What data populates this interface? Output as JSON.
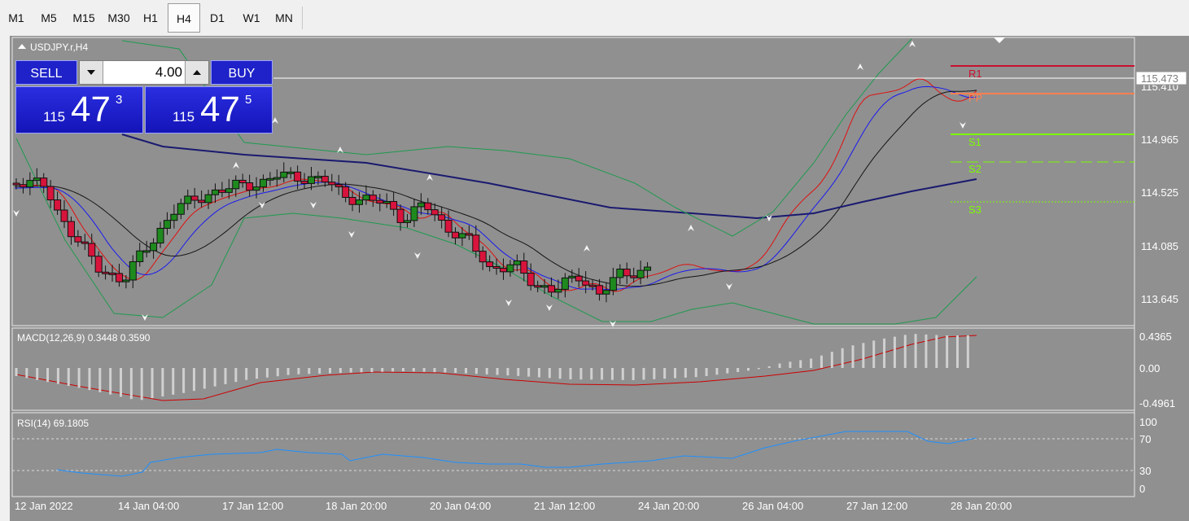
{
  "toolbar": {
    "timeframes": [
      "M1",
      "M5",
      "M15",
      "M30",
      "H1",
      "H4",
      "D1",
      "W1",
      "MN"
    ],
    "active": "H4"
  },
  "chart": {
    "symbol_label": "USDJPY.r,H4",
    "price_axis": [
      "115.410",
      "114.965",
      "114.525",
      "114.085",
      "113.645"
    ],
    "current_price": "115.473",
    "pivot_labels": [
      "R1",
      "PP",
      "S1",
      "S2",
      "S3"
    ],
    "time_axis": [
      "12 Jan 2022",
      "14 Jan 04:00",
      "17 Jan 12:00",
      "18 Jan 20:00",
      "20 Jan 04:00",
      "21 Jan 12:00",
      "24 Jan 20:00",
      "26 Jan 04:00",
      "27 Jan 12:00",
      "28 Jan 20:00"
    ]
  },
  "macd": {
    "label": "MACD(12,26,9) 0.3448 0.3590",
    "axis": [
      "0.4365",
      "0.00",
      "-0.4961"
    ]
  },
  "rsi": {
    "label": "RSI(14) 69.1805",
    "axis": [
      "100",
      "70",
      "30",
      "0"
    ]
  },
  "trade_panel": {
    "sell_label": "SELL",
    "buy_label": "BUY",
    "quantity": "4.00",
    "sell_price": {
      "prefix": "115",
      "big": "47",
      "sup": "3"
    },
    "buy_price": {
      "prefix": "115",
      "big": "47",
      "sup": "5"
    }
  },
  "colors": {
    "chart_bg": "#909090",
    "bull_candle": "#1e8a1e",
    "bear_candle": "#d8143c",
    "ma_fast": "#e01010",
    "ma_mid": "#1a1af0",
    "ma_slow": "#151515",
    "ma_long": "#1a1a70",
    "bands": "#1f9a4f",
    "r1": "#c8102e",
    "pp": "#ff7f50",
    "support": "#7cfc00",
    "macd_hist": "#d0d0d0",
    "macd_signal": "#cc0000",
    "rsi_line": "#1e90ff"
  },
  "icons": {
    "qty_down": "caret-down-icon",
    "qty_up": "caret-up-icon",
    "collapse": "triangle-up-icon",
    "chart_shift": "triangle-down-icon"
  }
}
